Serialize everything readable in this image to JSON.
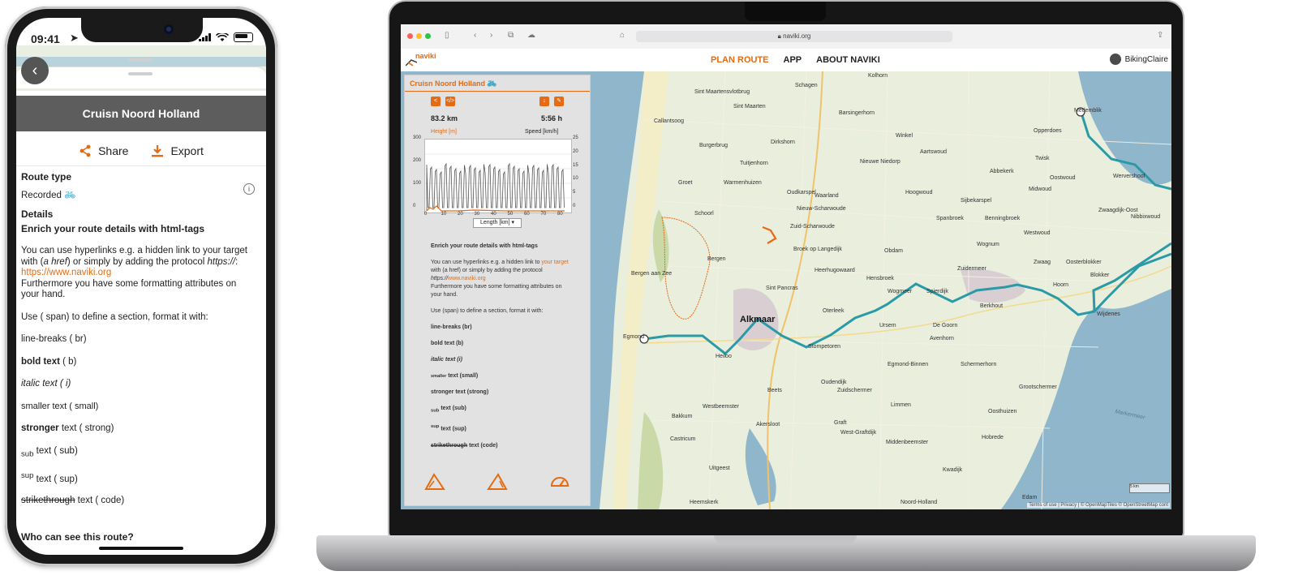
{
  "phone": {
    "status": {
      "time": "09:41"
    },
    "title": "Cruisn Noord Holland",
    "actions": {
      "share": "Share",
      "export": "Export"
    },
    "route_type_heading": "Route type",
    "route_type_value": "Recorded",
    "details_heading": "Details",
    "details_subtitle": "Enrich your route details with html-tags",
    "hyperlink_text_1": "You can use hyperlinks e.g. a hidden link to your target with (",
    "hyperlink_em": "a href",
    "hyperlink_text_2": ") or simply by adding the protocol ",
    "hyperlink_protocol": "https://",
    "hyperlink_text_3": ":",
    "hyperlink_url": "https://www.naviki.org",
    "formatting_text": "Furthermore you have some formatting attributes on your hand.",
    "span_text": "Use ( span) to define a section, format it with:",
    "items": {
      "line_breaks": "line-breaks ( br)",
      "bold": "bold text",
      "bold_tag": " ( b)",
      "italic": "italic text ( i)",
      "smaller": "smaller text ( small)",
      "stronger": "stronger",
      "stronger_tag": " text ( strong)",
      "sub_word": "sub",
      "sub_tag": " text ( sub)",
      "sup_word": "sup",
      "sup_tag": " text ( sup)",
      "strike": "strikethrough",
      "strike_tag": " text ( code)"
    },
    "visibility_heading": "Who can see this route?"
  },
  "laptop": {
    "browser": {
      "url": "naviki.org"
    },
    "logo": "naviki",
    "nav": {
      "plan_route": "PLAN ROUTE",
      "app": "APP",
      "about": "ABOUT NAVIKI"
    },
    "user": "BikingClaire",
    "panel": {
      "title": "Cruisn Noord Holland",
      "distance": "83.2 km",
      "duration": "5:56 h",
      "height_label": "Height [m]",
      "speed_label": "Speed [km/h]",
      "length_select": "Length [km]",
      "y_left_ticks": [
        "300",
        "200",
        "100",
        "0"
      ],
      "y_right_ticks": [
        "25",
        "20",
        "15",
        "10",
        "5",
        "0"
      ],
      "x_ticks": [
        "0",
        "10",
        "20",
        "30",
        "40",
        "50",
        "60",
        "70",
        "80"
      ],
      "enrich_title": "Enrich your route details with html-tags",
      "link_text_1": "You can use hyperlinks e.g. a hidden link to ",
      "link_target": "your target",
      "link_text_2": " with (a href) or simply by adding the protocol ",
      "link_protocol": "https://",
      "link_url": "www.naviki.org",
      "formatting_text": "Furthermore you have some formatting attributes on your hand.",
      "span_text": "Use (span) to define a section, format it with:",
      "line_breaks": "line-breaks (br)",
      "bold": "bold text (b)",
      "italic": "italic text (i)",
      "smaller_word": "smaller",
      "smaller_tag": " text (small)",
      "stronger": "stronger text (strong)",
      "sub_word": "sub",
      "sub_tag": " text (sub)",
      "sup_word": "sup",
      "sup_tag": " text (sup)",
      "strike": "strikethrough",
      "strike_tag": " text (code)"
    },
    "map_places": [
      "Kolhorn",
      "Schagen",
      "Sint Maartensvlotbrug",
      "Sint Maarten",
      "Barsingerhorn",
      "Medemblik",
      "Callantsoog",
      "Burgerbrug",
      "Dirkshorn",
      "Winkel",
      "Aartswoud",
      "Opperdoes",
      "Tuitjenhorn",
      "Nieuwe Niedorp",
      "Twisk",
      "Abbekerk",
      "Oostwoud",
      "Wervershoof",
      "Groet",
      "Warmenhuizen",
      "Waarland",
      "Hoogwoud",
      "Sijbekarspel",
      "Midwoud",
      "Zwaagdijk-Oost",
      "Oudkarspel",
      "Schoorl",
      "Nieuw-Scharwoude",
      "Spanbroek",
      "Benningbroek",
      "Nibbixwoud",
      "Westwoud",
      "Zuid-Scharwoude",
      "Wognum",
      "Broek op Langedijk",
      "Obdam",
      "Bergen",
      "Heerhugowaard",
      "Zuidermeer",
      "Zwaag",
      "Oosterblokker",
      "Bergen aan Zee",
      "Sint Pancras",
      "Hensbroek",
      "Wogmeer",
      "Spierdijk",
      "Hoorn",
      "Blokker",
      "Alkmaar",
      "Oterleek",
      "Berkhout",
      "Wijdenes",
      "Egmond",
      "Ursem",
      "De Goorn",
      "Heiloo",
      "Stompetoren",
      "Avenhorn",
      "Egmond-Binnen",
      "Schermerhorn",
      "Oudendijk",
      "Beets",
      "Zuidschermer",
      "Grootschermer",
      "Limmen",
      "Westbeemster",
      "Oosthuizen",
      "Bakkum",
      "Akersloot",
      "Graft",
      "West-Graftdijk",
      "Middenbeemster",
      "Hobrede",
      "Castricum",
      "Uitgeest",
      "Kwadijk",
      "Heemskerk",
      "Noord-Holland",
      "Edam",
      "Markermeer"
    ],
    "scale": "5 km",
    "attribution": "Terms of use | Privacy | © OpenMapTiles © OpenStreetMap cont"
  },
  "colors": {
    "accent": "#e46b13",
    "route": "#2a9aa7",
    "water": "#8fb6cb"
  }
}
